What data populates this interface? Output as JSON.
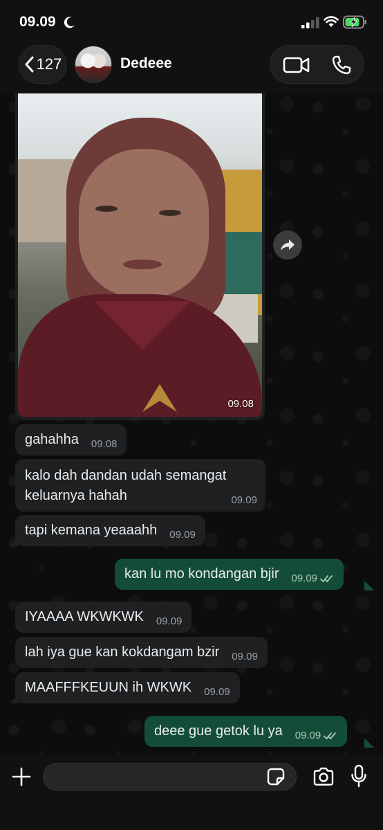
{
  "status_bar": {
    "time": "09.09"
  },
  "header": {
    "back_count": "127",
    "contact_name": "Dedeee"
  },
  "image_message": {
    "time": "09.08"
  },
  "messages": [
    {
      "dir": "in",
      "text": "gahahha",
      "time": "09.08"
    },
    {
      "dir": "in",
      "text": "kalo dah dandan udah semangat keluarnya hahah",
      "time": "09.09"
    },
    {
      "dir": "in",
      "text": "tapi kemana yeaaahh",
      "time": "09.09"
    },
    {
      "dir": "out",
      "text": "kan lu mo kondangan bjir",
      "time": "09.09",
      "status": "read"
    },
    {
      "dir": "in",
      "text": "IYAAAA WKWKWK",
      "time": "09.09"
    },
    {
      "dir": "in",
      "text": "lah iya gue kan kokdangam bzir",
      "time": "09.09"
    },
    {
      "dir": "in",
      "text": "MAAFFFKEUUN ih WKWK",
      "time": "09.09"
    },
    {
      "dir": "out",
      "text": "deee gue getok lu ya",
      "time": "09.09",
      "status": "read"
    }
  ],
  "input": {
    "value": "",
    "placeholder": ""
  },
  "colors": {
    "incoming_bubble": "#1f2022",
    "outgoing_bubble": "#144d37",
    "read_ticks": "#a9c6b8",
    "battery_charging": "#4cd964"
  }
}
